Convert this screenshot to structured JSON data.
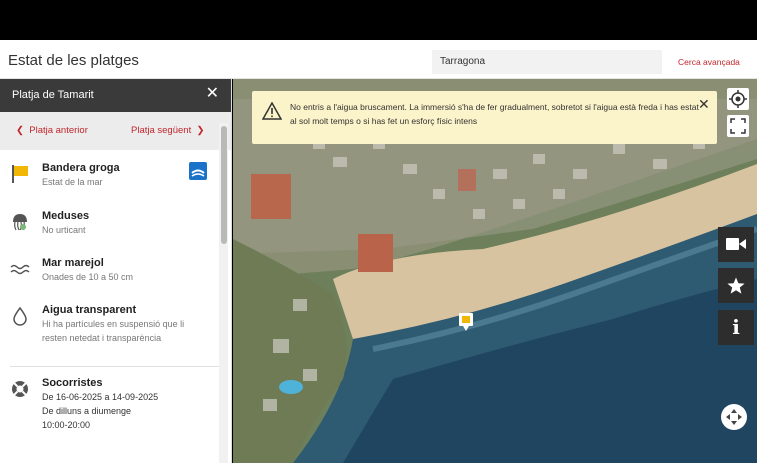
{
  "header": {
    "title": "Estat de les platges",
    "search_value": "Tarragona",
    "advanced_search": "Cerca avançada"
  },
  "sidebar": {
    "beach_name": "Platja de Tamarit",
    "prev_label": "Platja anterior",
    "next_label": "Platja següent",
    "items": [
      {
        "title": "Bandera groga",
        "subtitle": "Estat de la mar",
        "icon": "yellow-flag-icon",
        "color": "#f2b705"
      },
      {
        "title": "Meduses",
        "subtitle": "No urticant",
        "icon": "jellyfish-icon"
      },
      {
        "title": "Mar marejol",
        "subtitle": "Onades de 10 a 50 cm",
        "icon": "waves-icon"
      },
      {
        "title": "Aigua transparent",
        "subtitle": "Hi ha partícules en suspensió que li resten netedat i transparència",
        "icon": "water-drop-icon"
      },
      {
        "title": "Socorristes",
        "line1": "De 16-06-2025 a 14-09-2025",
        "line2": "De dilluns a diumenge",
        "line3": "10:00-20:00",
        "icon": "lifebuoy-icon"
      }
    ]
  },
  "alert": {
    "text": "No entris a l'aigua bruscament. La immersió s'ha de fer gradualment, sobretot si l'aigua està freda i has estat al sol molt temps o si has fet un esforç físic intens",
    "bg_color": "#fbf3c9"
  },
  "map_controls": [
    "locate-icon",
    "fullscreen-icon",
    "video-camera-icon",
    "star-icon",
    "info-icon",
    "pan-icon"
  ],
  "accent_color": "#c0272d"
}
